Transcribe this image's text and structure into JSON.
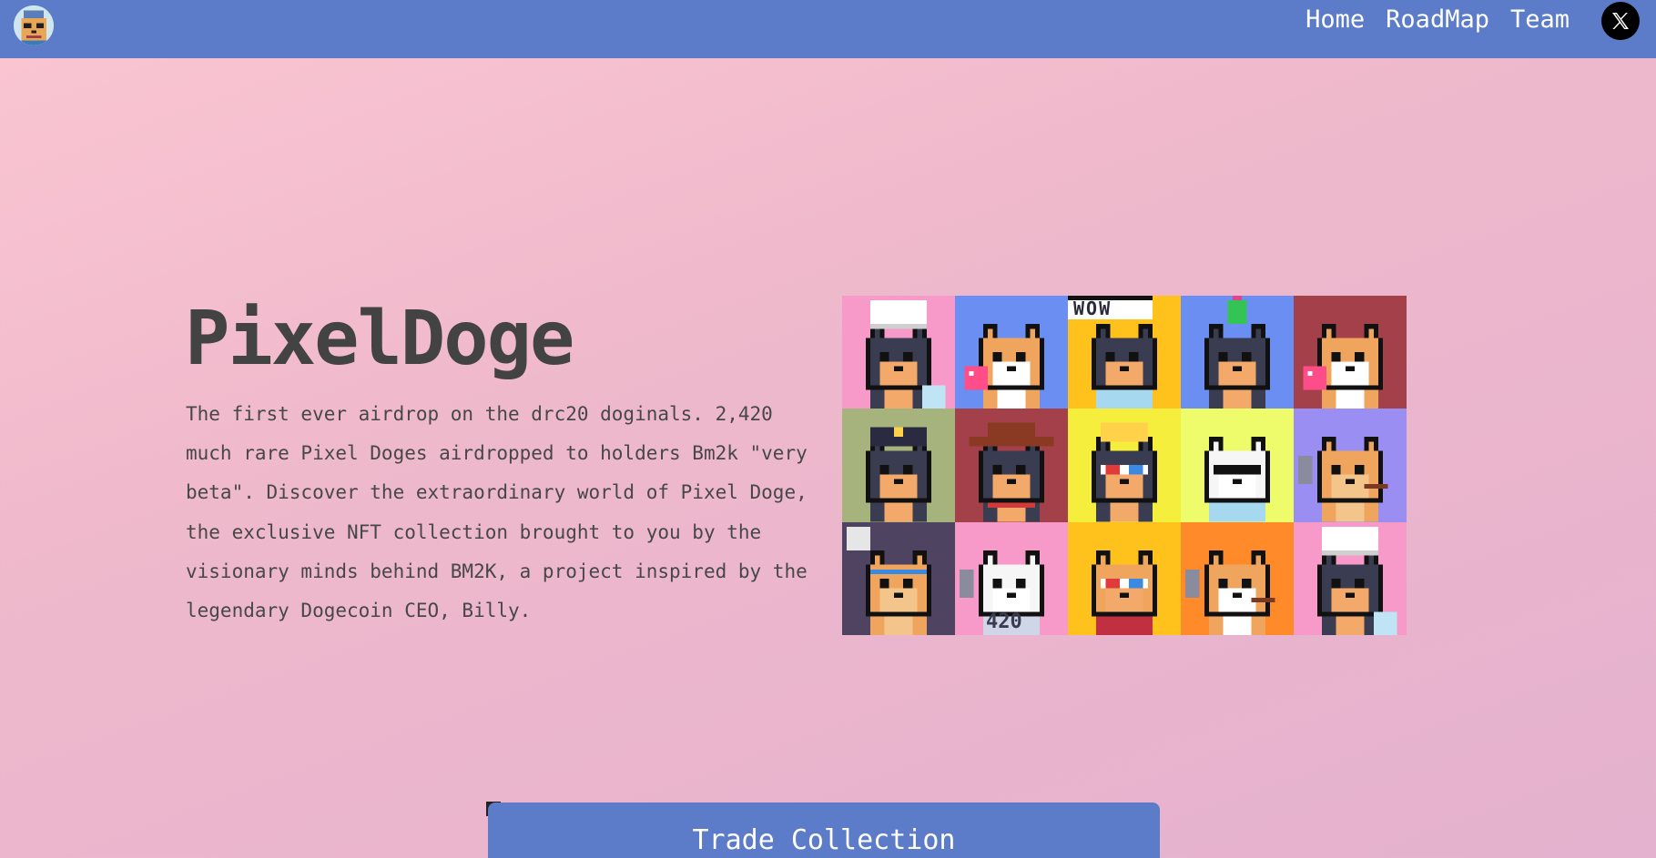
{
  "nav": {
    "logo_name": "pixel-doge-logo",
    "links": [
      "Home",
      "RoadMap",
      "Team"
    ],
    "social_icon": "x-icon"
  },
  "hero": {
    "title": "PixelDoge",
    "description": "The first ever airdrop on the drc20 doginals. 2,420 much rare Pixel Doges airdropped to holders Bm2k \"very beta\". Discover the extraordinary world of Pixel Doge, the exclusive NFT collection brought to you by the visionary minds behind BM2K, a project inspired by the legendary Dogecoin CEO, Billy."
  },
  "gallery": {
    "tiles": [
      {
        "bg": "#f79ac9",
        "fur": "#3a3c52",
        "face": "#f3a96a",
        "accessory": "chef-hat"
      },
      {
        "bg": "#6b8ef2",
        "fur": "#f0a55e",
        "face": "#ffffff",
        "accessory": "bubblegum"
      },
      {
        "bg": "#ffc21c",
        "fur": "#3a3c52",
        "face": "#f3a96a",
        "accessory": "wow-bubble",
        "label": "WOW"
      },
      {
        "bg": "#6b8ef2",
        "fur": "#3a3c52",
        "face": "#f3a96a",
        "accessory": "party-hat"
      },
      {
        "bg": "#a4404a",
        "fur": "#f0a55e",
        "face": "#ffffff",
        "accessory": "bubblegum"
      },
      {
        "bg": "#a6b37c",
        "fur": "#3a3c52",
        "face": "#f3a96a",
        "accessory": "police-cap"
      },
      {
        "bg": "#a4404a",
        "fur": "#3a3c52",
        "face": "#f3a96a",
        "accessory": "cowboy-hat"
      },
      {
        "bg": "#f6ee3c",
        "fur": "#3a3c52",
        "face": "#f3a96a",
        "accessory": "crown-3d-glasses"
      },
      {
        "bg": "#eefc6b",
        "fur": "#f6f6f6",
        "face": "#ffffff",
        "accessory": "sunglasses"
      },
      {
        "bg": "#9a8ef2",
        "fur": "#f0a55e",
        "face": "#f3c58a",
        "accessory": "cigar"
      },
      {
        "bg": "#4e4462",
        "fur": "#f0a55e",
        "face": "#f3c58a",
        "accessory": "headband"
      },
      {
        "bg": "#f79ac9",
        "fur": "#f6f6f6",
        "face": "#ffffff",
        "accessory": "420-shirt",
        "label": "420"
      },
      {
        "bg": "#ffc21c",
        "fur": "#f0a55e",
        "face": "#f3a96a",
        "accessory": "3d-glasses"
      },
      {
        "bg": "#ff8a2a",
        "fur": "#f0a55e",
        "face": "#ffffff",
        "accessory": "cigar"
      },
      {
        "bg": "#f79ac9",
        "fur": "#3a3c52",
        "face": "#f3a96a",
        "accessory": "chef-hat"
      }
    ]
  },
  "cta": {
    "label": "Trade Collection"
  },
  "colors": {
    "primary": "#5c7bc9",
    "text": "#454545",
    "background_start": "#fbc6d2",
    "background_end": "#e4b1ce"
  }
}
